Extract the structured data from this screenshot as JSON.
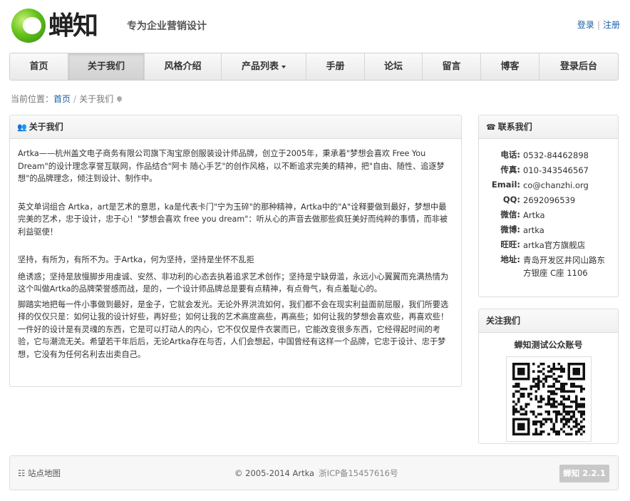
{
  "header": {
    "logo_text": "蝉知",
    "slogan": "专为企业营销设计",
    "login": "登录",
    "separator": "|",
    "register": "注册"
  },
  "nav": {
    "items": [
      {
        "label": "首页"
      },
      {
        "label": "关于我们",
        "active": true
      },
      {
        "label": "风格介绍"
      },
      {
        "label": "产品列表"
      },
      {
        "label": "手册"
      },
      {
        "label": "论坛"
      },
      {
        "label": "留言"
      },
      {
        "label": "博客"
      },
      {
        "label": "登录后台"
      }
    ]
  },
  "breadcrumb": {
    "prefix": "当前位置：",
    "home": "首页",
    "separator": "/",
    "current": "关于我们"
  },
  "main": {
    "title": "关于我们",
    "paragraphs": [
      "Artka——杭州盖文电子商务有限公司旗下淘宝原创服装设计师品牌，创立于2005年，秉承着\"梦想会喜欢 Free You Dream\"的设计理念享誉互联网，作品结合\"阿卡 随心手艺\"的创作风格，以不断追求完美的精神，把\"自由、随性、追逐梦想\"的品牌理念，倾注到设计、制作中。",
      "英文单词组合 Artka，art是艺术的意思，ka是代表卡门\"宁为玉碎\"的那种精神，Artka中的\"A\"诠释要做到最好，梦想中最完美的艺术，忠于设计，忠于心！\"梦想会喜欢 free you dream\"：听从心的声音去做那些疯狂美好而纯粹的事情，而非被利益驱使！",
      "坚持，有所为，有所不为。于Artka，何为坚持，坚持是坐怀不乱拒",
      "绝诱惑；坚持是放慢脚步用虔诚、安然、非功利的心态去执着追求艺术创作；坚持是宁缺毋滥，永远小心翼翼而充满热情为这个叫做Artka的品牌荣誉感而战，是的，一个设计师品牌总是要有点精神，有点骨气，有点羞耻心的。",
      "脚踏实地把每一件小事做到最好，是金子，它就会发光。无论外界洪流如何，我们都不会在现实利益面前屈服，我们所要选择的仅仅只是：如何让我的设计好些，再好些；如何让我的艺术高度高些，再高些；如何让我的梦想会喜欢些，再喜欢些！一件好的设计是有灵魂的东西，它是可以打动人的内心，它不仅仅是件衣裳而已，它能改变很多东西，它经得起时间的考验，它与潮流无关。希望若干年后后，无论Artka存在与否，人们会想起，中国曾经有这样一个品牌，它忠于设计、忠于梦想，它没有为任何名利去出卖自己。"
    ]
  },
  "contact": {
    "title": "联系我们",
    "rows": [
      {
        "label": "电话:",
        "value": "0532-84462898",
        "link": true
      },
      {
        "label": "传真:",
        "value": "010-343546567",
        "link": false
      },
      {
        "label": "Email:",
        "value": "co@chanzhi.org",
        "link": true
      },
      {
        "label": "QQ:",
        "value": "2692096539",
        "link": true
      },
      {
        "label": "微信:",
        "value": "Artka",
        "link": false
      },
      {
        "label": "微博:",
        "value": "artka",
        "link": true
      },
      {
        "label": "旺旺:",
        "value": "artka官方旗舰店",
        "link": true
      },
      {
        "label": "地址:",
        "value": "青岛开发区井冈山路东方银座 C座 1106",
        "link": false
      }
    ]
  },
  "follow": {
    "title": "关注我们",
    "account": "蝉知测试公众账号"
  },
  "footer": {
    "sitemap": "站点地图",
    "copyright": "© 2005-2014 Artka",
    "icp": "浙ICP备15457616号",
    "badge": "蝉知 2.2.1"
  },
  "colors": {
    "link": "#1a5fa8",
    "logo_green": "#66c21c"
  }
}
